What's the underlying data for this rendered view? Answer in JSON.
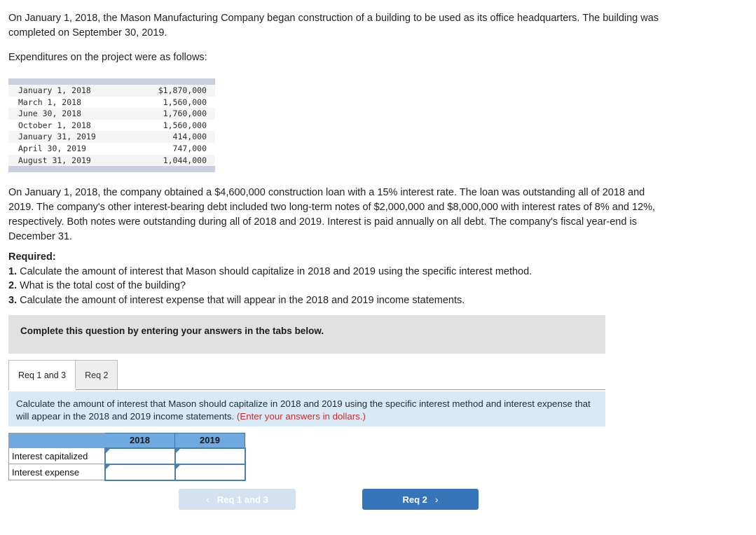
{
  "intro": {
    "paragraph1": "On January 1, 2018, the Mason Manufacturing Company began construction of a building to be used as its office headquarters. The building was completed on September 30, 2019.",
    "paragraph2": "Expenditures on the project were as follows:"
  },
  "expenditures": {
    "rows": [
      {
        "date": "January 1, 2018",
        "amount": "$1,870,000"
      },
      {
        "date": "March 1, 2018",
        "amount": "1,560,000"
      },
      {
        "date": "June 30, 2018",
        "amount": "1,760,000"
      },
      {
        "date": "October 1, 2018",
        "amount": "1,560,000"
      },
      {
        "date": "January 31, 2019",
        "amount": "414,000"
      },
      {
        "date": "April 30, 2019",
        "amount": "747,000"
      },
      {
        "date": "August 31, 2019",
        "amount": "1,044,000"
      }
    ]
  },
  "body": {
    "paragraph": "On January 1, 2018, the company obtained a $4,600,000 construction loan with a 15% interest rate. The loan was outstanding all of 2018 and 2019. The company's other interest-bearing debt included two long-term notes of $2,000,000 and $8,000,000 with interest rates of 8% and 12%, respectively. Both notes were outstanding during all of 2018 and 2019. Interest is paid annually on all debt. The company's fiscal year-end is December 31."
  },
  "required": {
    "heading": "Required:",
    "items": [
      {
        "num": "1.",
        "text": " Calculate the amount of interest that Mason should capitalize in 2018 and 2019 using the specific interest method."
      },
      {
        "num": "2.",
        "text": " What is the total cost of the building?"
      },
      {
        "num": "3.",
        "text": " Calculate the amount of interest expense that will appear in the 2018 and 2019 income statements."
      }
    ]
  },
  "banner": {
    "text": "Complete this question by entering your answers in the tabs below."
  },
  "tabs": [
    {
      "label": "Req 1 and 3",
      "active": true
    },
    {
      "label": "Req 2",
      "active": false
    }
  ],
  "instruction": {
    "main": "Calculate the amount of interest that Mason should capitalize in 2018 and 2019 using the specific interest method and interest expense that will appear in the 2018 and 2019 income statements.",
    "note": "(Enter your answers in dollars.)"
  },
  "answer_table": {
    "headers": [
      "",
      "2018",
      "2019"
    ],
    "rows": [
      {
        "label": "Interest capitalized",
        "values": [
          "",
          ""
        ]
      },
      {
        "label": "Interest expense",
        "values": [
          "",
          ""
        ]
      }
    ]
  },
  "nav": {
    "prev_label": "Req 1 and 3",
    "prev_chevron": "‹",
    "next_label": "Req 2",
    "next_chevron": "›"
  },
  "colors": {
    "accent_blue": "#3775bb",
    "header_blue": "#6ea9e0",
    "instruction_blue": "#d9eaf7",
    "banner_gray": "#e1e1e1",
    "prev_button": "#d4e1f0",
    "red_note": "#cc2a2a"
  }
}
